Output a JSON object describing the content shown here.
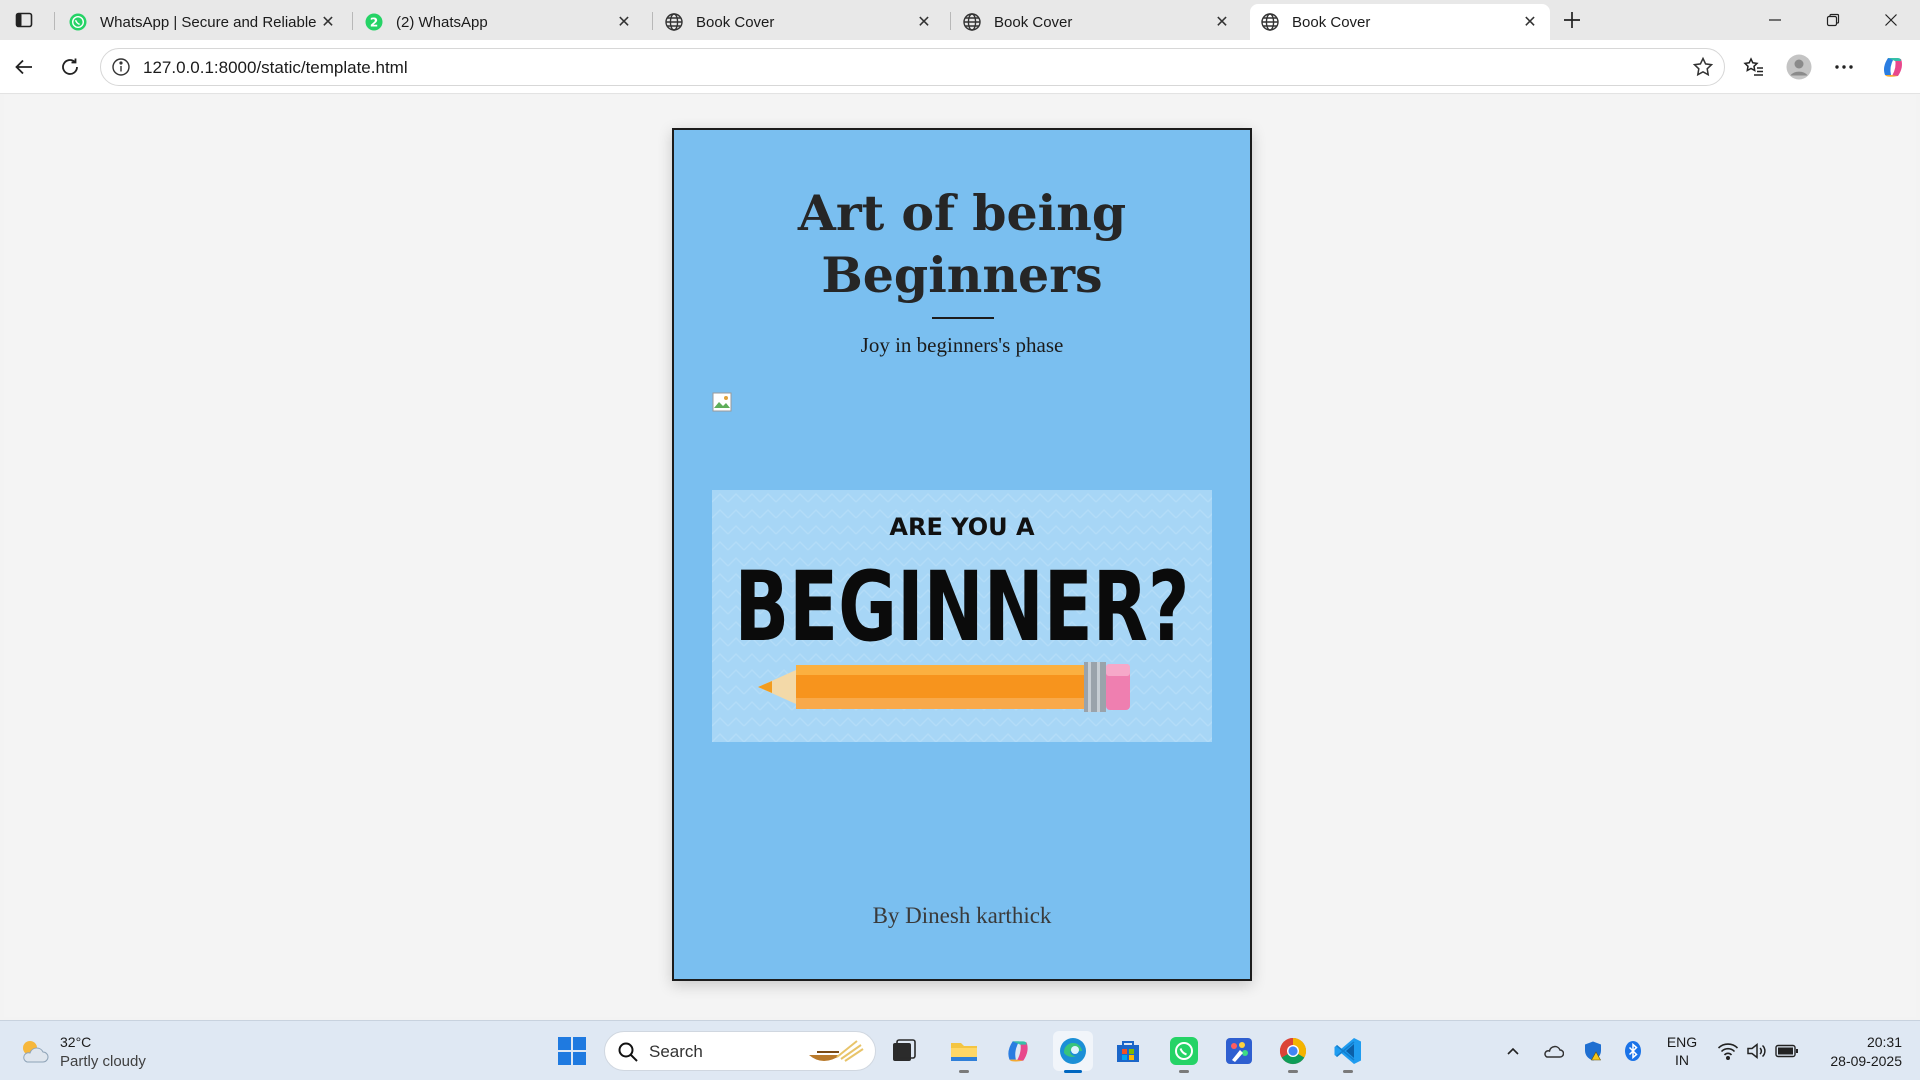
{
  "browser": {
    "tabs": [
      {
        "label": "WhatsApp | Secure and Reliable F",
        "icon": "whatsapp-icon"
      },
      {
        "label": "(2) WhatsApp",
        "icon": "whatsapp-badge-icon",
        "badge": "2"
      },
      {
        "label": "Book Cover",
        "icon": "globe-icon"
      },
      {
        "label": "Book Cover",
        "icon": "globe-icon"
      },
      {
        "label": "Book Cover",
        "icon": "globe-icon",
        "active": true
      }
    ],
    "address": "127.0.0.1:8000/static/template.html"
  },
  "page": {
    "title_line1": "Art of being",
    "title_line2": "Beginners",
    "subtitle": "Joy in beginners's phase",
    "art_line1": "ARE YOU A",
    "art_line2": "BEGINNER?",
    "author": "By Dinesh karthick",
    "cover_color": "#7abff0"
  },
  "taskbar": {
    "weather_temp": "32°C",
    "weather_condition": "Partly cloudy",
    "search_label": "Search",
    "apps": [
      "start-icon",
      "task-view-icon",
      "file-explorer-icon",
      "copilot-icon",
      "edge-icon",
      "microsoft-store-icon",
      "whatsapp-icon",
      "paint-icon",
      "chrome-icon",
      "vscode-icon"
    ],
    "lang_line1": "ENG",
    "lang_line2": "IN",
    "time": "20:31",
    "date": "28-09-2025"
  }
}
